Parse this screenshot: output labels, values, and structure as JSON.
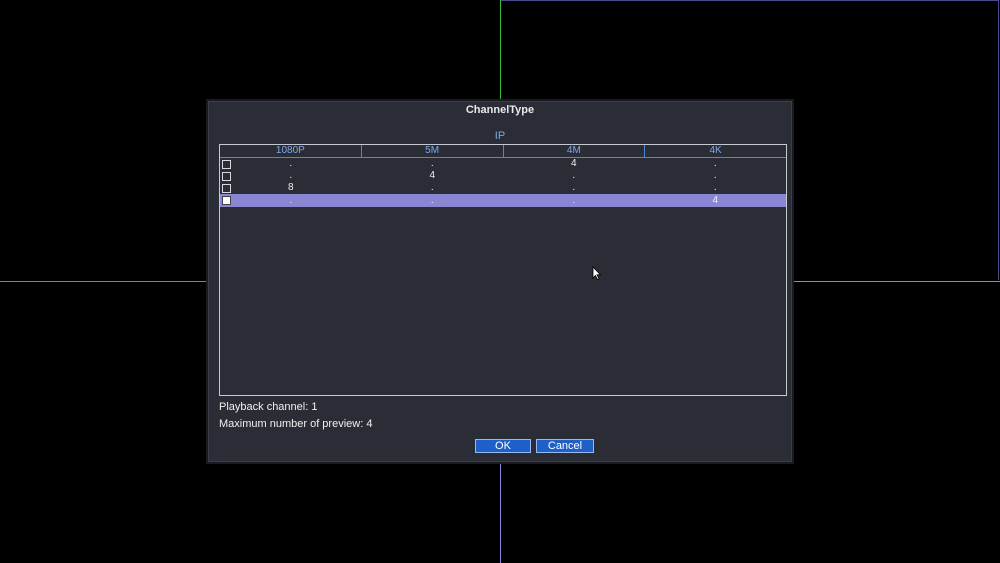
{
  "dialog": {
    "title": "ChannelType",
    "section_label": "IP",
    "columns": [
      "1080P",
      "5M",
      "4M",
      "4K"
    ],
    "rows": [
      {
        "checked": false,
        "selected": false,
        "cells": [
          ".",
          ".",
          "4",
          "."
        ]
      },
      {
        "checked": false,
        "selected": false,
        "cells": [
          ".",
          "4",
          ".",
          "."
        ]
      },
      {
        "checked": false,
        "selected": false,
        "cells": [
          "8",
          ".",
          ".",
          "."
        ]
      },
      {
        "checked": true,
        "selected": true,
        "cells": [
          ".",
          ".",
          ".",
          "4"
        ]
      }
    ],
    "playback_channel": "Playback channel: 1",
    "max_preview": "Maximum number of preview: 4",
    "ok_label": "OK",
    "cancel_label": "Cancel"
  },
  "colors": {
    "dialog_bg": "#2b2d36",
    "header_text": "#7fa8e8",
    "selected_row": "#8a86d4",
    "button_bg": "#1f5fc8",
    "grid_line_green": "#39b83a",
    "grid_line_purple": "#8a87d6"
  },
  "icons": {
    "cursor": "mouse-pointer-icon",
    "checkbox": "checkbox-icon"
  }
}
